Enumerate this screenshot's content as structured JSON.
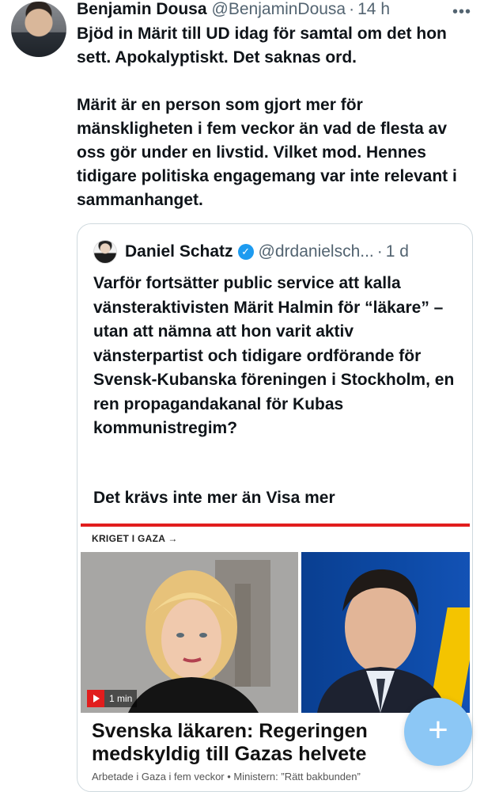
{
  "tweet": {
    "author_name": "Benjamin Dousa",
    "author_handle": "@BenjaminDousa",
    "separator": "·",
    "time": "14 h",
    "more_icon": "more-horizontal-icon",
    "text": "Bjöd in Märit till UD idag för samtal om det hon sett. Apokalyptiskt. Det saknas ord.\n\nMärit är en person som gjort mer för mänskligheten i fem veckor än vad de flesta av oss gör under en livstid. Vilket mod. Hennes tidigare politiska engagemang var inte relevant i sammanhanget."
  },
  "quoted": {
    "author_name": "Daniel Schatz",
    "author_handle": "@drdanielsch...",
    "separator": "·",
    "time": "1 d",
    "verified_icon": "verified-badge-icon",
    "text": "Varför fortsätter public service att kalla vänsteraktivisten Märit Halmin för “läkare” – utan att nämna att hon varit aktiv vänsterpartist och tidigare ordförande för Svensk-Kubanska föreningen i Stockholm, en ren propagandakanal för Kubas kommunistregim?",
    "truncated_text": "Det krävs inte mer än",
    "show_more_label": "Visa mer"
  },
  "article": {
    "kicker": "KRIGET I GAZA →",
    "video_duration": "1 min",
    "headline": "Svenska läkaren: Regeringen medskyldig till Gazas helvete",
    "subline": "Arbetade i Gaza i fem veckor • Ministern: ”Rätt bakbunden”",
    "accent_color": "#e11d1d"
  },
  "fab": {
    "label": "+",
    "icon": "compose-plus-icon",
    "color": "#8cc7f5"
  },
  "colors": {
    "link_blue": "#1d9bf0",
    "muted": "#536471"
  }
}
